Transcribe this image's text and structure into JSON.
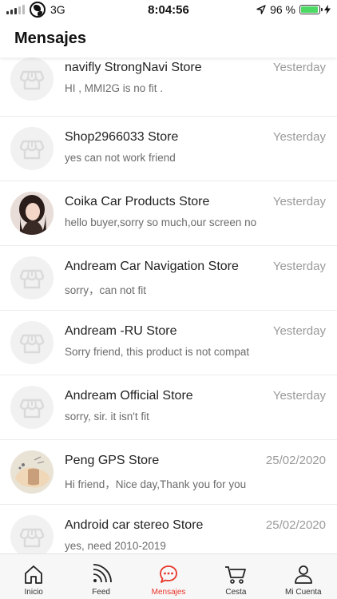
{
  "status_bar": {
    "network": "3G",
    "time": "8:04:56",
    "battery": "96 %",
    "battery_level": 0.96
  },
  "header": {
    "title": "Mensajes"
  },
  "conversations": [
    {
      "store": "navifly StrongNavi Store",
      "time": "Yesterday",
      "message": "HI , MMI2G is no fit .",
      "avatar": "store-icon"
    },
    {
      "store": "Shop2966033 Store",
      "time": "Yesterday",
      "message": "yes can not work friend",
      "avatar": "store-icon"
    },
    {
      "store": "Coika Car Products Store",
      "time": "Yesterday",
      "message": "hello buyer,sorry so much,our screen no",
      "avatar": "photo"
    },
    {
      "store": "Andream Car Navigation Store",
      "time": "Yesterday",
      "message": "sorry，can not fit",
      "avatar": "store-icon"
    },
    {
      "store": "Andream -RU Store",
      "time": "Yesterday",
      "message": "Sorry friend, this product is not compat",
      "avatar": "store-icon"
    },
    {
      "store": "Andream Official Store",
      "time": "Yesterday",
      "message": "sorry, sir. it isn't fit",
      "avatar": "store-icon"
    },
    {
      "store": "Peng GPS Store",
      "time": "25/02/2020",
      "message": "Hi friend，Nice day,Thank you for you",
      "avatar": "photo"
    },
    {
      "store": "Android car stereo Store",
      "time": "25/02/2020",
      "message": "yes, need  2010-2019",
      "avatar": "store-icon"
    }
  ],
  "tabbar": {
    "tabs": [
      {
        "label": "Inicio",
        "icon": "home-icon"
      },
      {
        "label": "Feed",
        "icon": "feed-icon"
      },
      {
        "label": "Mensajes",
        "icon": "chat-icon",
        "active": true
      },
      {
        "label": "Cesta",
        "icon": "cart-icon"
      },
      {
        "label": "Mi Cuenta",
        "icon": "account-icon"
      }
    ]
  },
  "colors": {
    "accent": "#e8342a",
    "muted_text": "#9a9a9a",
    "battery": "#4cd964"
  }
}
